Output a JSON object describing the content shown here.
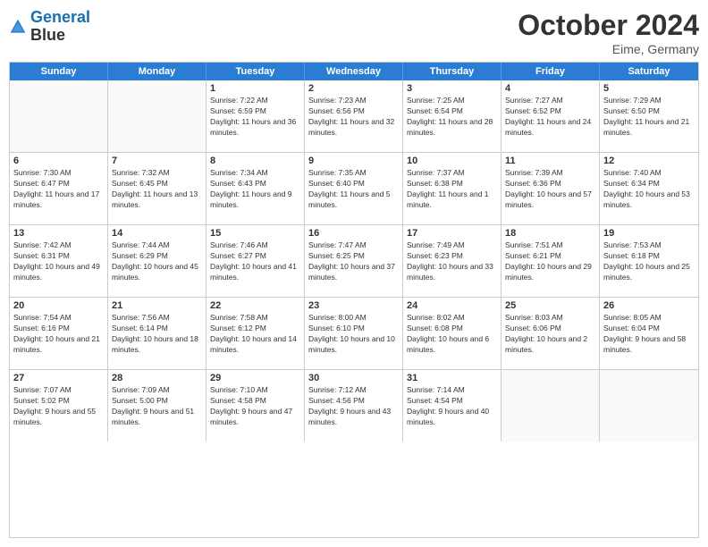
{
  "logo": {
    "line1": "General",
    "line2": "Blue"
  },
  "title": "October 2024",
  "subtitle": "Eime, Germany",
  "header_days": [
    "Sunday",
    "Monday",
    "Tuesday",
    "Wednesday",
    "Thursday",
    "Friday",
    "Saturday"
  ],
  "weeks": [
    [
      {
        "day": "",
        "sunrise": "",
        "sunset": "",
        "daylight": ""
      },
      {
        "day": "",
        "sunrise": "",
        "sunset": "",
        "daylight": ""
      },
      {
        "day": "1",
        "sunrise": "Sunrise: 7:22 AM",
        "sunset": "Sunset: 6:59 PM",
        "daylight": "Daylight: 11 hours and 36 minutes."
      },
      {
        "day": "2",
        "sunrise": "Sunrise: 7:23 AM",
        "sunset": "Sunset: 6:56 PM",
        "daylight": "Daylight: 11 hours and 32 minutes."
      },
      {
        "day": "3",
        "sunrise": "Sunrise: 7:25 AM",
        "sunset": "Sunset: 6:54 PM",
        "daylight": "Daylight: 11 hours and 28 minutes."
      },
      {
        "day": "4",
        "sunrise": "Sunrise: 7:27 AM",
        "sunset": "Sunset: 6:52 PM",
        "daylight": "Daylight: 11 hours and 24 minutes."
      },
      {
        "day": "5",
        "sunrise": "Sunrise: 7:29 AM",
        "sunset": "Sunset: 6:50 PM",
        "daylight": "Daylight: 11 hours and 21 minutes."
      }
    ],
    [
      {
        "day": "6",
        "sunrise": "Sunrise: 7:30 AM",
        "sunset": "Sunset: 6:47 PM",
        "daylight": "Daylight: 11 hours and 17 minutes."
      },
      {
        "day": "7",
        "sunrise": "Sunrise: 7:32 AM",
        "sunset": "Sunset: 6:45 PM",
        "daylight": "Daylight: 11 hours and 13 minutes."
      },
      {
        "day": "8",
        "sunrise": "Sunrise: 7:34 AM",
        "sunset": "Sunset: 6:43 PM",
        "daylight": "Daylight: 11 hours and 9 minutes."
      },
      {
        "day": "9",
        "sunrise": "Sunrise: 7:35 AM",
        "sunset": "Sunset: 6:40 PM",
        "daylight": "Daylight: 11 hours and 5 minutes."
      },
      {
        "day": "10",
        "sunrise": "Sunrise: 7:37 AM",
        "sunset": "Sunset: 6:38 PM",
        "daylight": "Daylight: 11 hours and 1 minute."
      },
      {
        "day": "11",
        "sunrise": "Sunrise: 7:39 AM",
        "sunset": "Sunset: 6:36 PM",
        "daylight": "Daylight: 10 hours and 57 minutes."
      },
      {
        "day": "12",
        "sunrise": "Sunrise: 7:40 AM",
        "sunset": "Sunset: 6:34 PM",
        "daylight": "Daylight: 10 hours and 53 minutes."
      }
    ],
    [
      {
        "day": "13",
        "sunrise": "Sunrise: 7:42 AM",
        "sunset": "Sunset: 6:31 PM",
        "daylight": "Daylight: 10 hours and 49 minutes."
      },
      {
        "day": "14",
        "sunrise": "Sunrise: 7:44 AM",
        "sunset": "Sunset: 6:29 PM",
        "daylight": "Daylight: 10 hours and 45 minutes."
      },
      {
        "day": "15",
        "sunrise": "Sunrise: 7:46 AM",
        "sunset": "Sunset: 6:27 PM",
        "daylight": "Daylight: 10 hours and 41 minutes."
      },
      {
        "day": "16",
        "sunrise": "Sunrise: 7:47 AM",
        "sunset": "Sunset: 6:25 PM",
        "daylight": "Daylight: 10 hours and 37 minutes."
      },
      {
        "day": "17",
        "sunrise": "Sunrise: 7:49 AM",
        "sunset": "Sunset: 6:23 PM",
        "daylight": "Daylight: 10 hours and 33 minutes."
      },
      {
        "day": "18",
        "sunrise": "Sunrise: 7:51 AM",
        "sunset": "Sunset: 6:21 PM",
        "daylight": "Daylight: 10 hours and 29 minutes."
      },
      {
        "day": "19",
        "sunrise": "Sunrise: 7:53 AM",
        "sunset": "Sunset: 6:18 PM",
        "daylight": "Daylight: 10 hours and 25 minutes."
      }
    ],
    [
      {
        "day": "20",
        "sunrise": "Sunrise: 7:54 AM",
        "sunset": "Sunset: 6:16 PM",
        "daylight": "Daylight: 10 hours and 21 minutes."
      },
      {
        "day": "21",
        "sunrise": "Sunrise: 7:56 AM",
        "sunset": "Sunset: 6:14 PM",
        "daylight": "Daylight: 10 hours and 18 minutes."
      },
      {
        "day": "22",
        "sunrise": "Sunrise: 7:58 AM",
        "sunset": "Sunset: 6:12 PM",
        "daylight": "Daylight: 10 hours and 14 minutes."
      },
      {
        "day": "23",
        "sunrise": "Sunrise: 8:00 AM",
        "sunset": "Sunset: 6:10 PM",
        "daylight": "Daylight: 10 hours and 10 minutes."
      },
      {
        "day": "24",
        "sunrise": "Sunrise: 8:02 AM",
        "sunset": "Sunset: 6:08 PM",
        "daylight": "Daylight: 10 hours and 6 minutes."
      },
      {
        "day": "25",
        "sunrise": "Sunrise: 8:03 AM",
        "sunset": "Sunset: 6:06 PM",
        "daylight": "Daylight: 10 hours and 2 minutes."
      },
      {
        "day": "26",
        "sunrise": "Sunrise: 8:05 AM",
        "sunset": "Sunset: 6:04 PM",
        "daylight": "Daylight: 9 hours and 58 minutes."
      }
    ],
    [
      {
        "day": "27",
        "sunrise": "Sunrise: 7:07 AM",
        "sunset": "Sunset: 5:02 PM",
        "daylight": "Daylight: 9 hours and 55 minutes."
      },
      {
        "day": "28",
        "sunrise": "Sunrise: 7:09 AM",
        "sunset": "Sunset: 5:00 PM",
        "daylight": "Daylight: 9 hours and 51 minutes."
      },
      {
        "day": "29",
        "sunrise": "Sunrise: 7:10 AM",
        "sunset": "Sunset: 4:58 PM",
        "daylight": "Daylight: 9 hours and 47 minutes."
      },
      {
        "day": "30",
        "sunrise": "Sunrise: 7:12 AM",
        "sunset": "Sunset: 4:56 PM",
        "daylight": "Daylight: 9 hours and 43 minutes."
      },
      {
        "day": "31",
        "sunrise": "Sunrise: 7:14 AM",
        "sunset": "Sunset: 4:54 PM",
        "daylight": "Daylight: 9 hours and 40 minutes."
      },
      {
        "day": "",
        "sunrise": "",
        "sunset": "",
        "daylight": ""
      },
      {
        "day": "",
        "sunrise": "",
        "sunset": "",
        "daylight": ""
      }
    ]
  ]
}
